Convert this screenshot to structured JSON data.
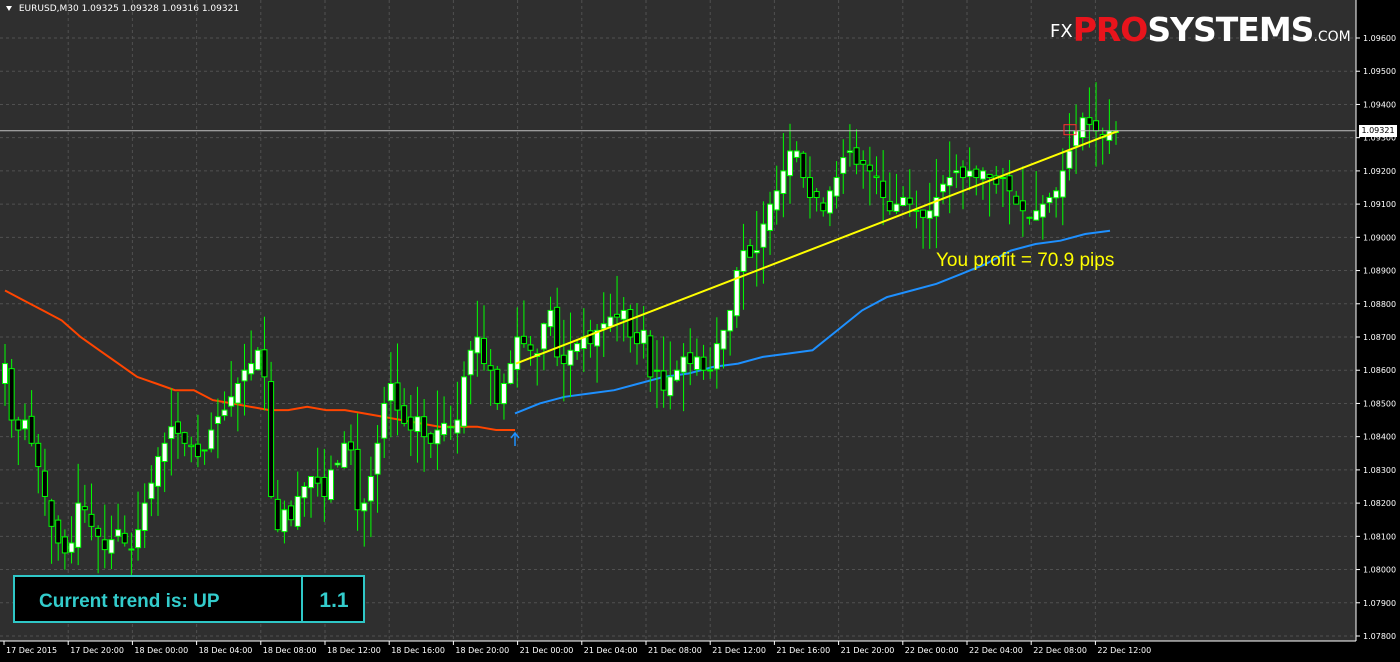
{
  "header": {
    "symbol": "EURUSD,M30",
    "ohlc": "1.09325 1.09328 1.09316 1.09321"
  },
  "logo": {
    "fx": "FX",
    "pro": "PRO",
    "systems": "SYSTEMS",
    "com": ".COM"
  },
  "current_price": "1.09321",
  "profit_text": "You profit = 70.9 pips",
  "trend": {
    "label": "Current trend is: UP",
    "value": "1.1"
  },
  "colors": {
    "background": "#000000",
    "chart_bg": "#2f2f2f",
    "grid": "#505050",
    "candle": "#00ff00",
    "candle_up_fill": "#ffffff",
    "ma_before": "#ff4500",
    "ma_after": "#1e90ff",
    "trend_line": "#ffff00",
    "trend_box": "#2fc7c7"
  },
  "chart_data": {
    "type": "candlestick",
    "symbol": "EURUSD",
    "timeframe": "M30",
    "y_ticks": [
      "1.09600",
      "1.09500",
      "1.09400",
      "1.09300",
      "1.09200",
      "1.09100",
      "1.09000",
      "1.08900",
      "1.08800",
      "1.08700",
      "1.08600",
      "1.08500",
      "1.08400",
      "1.08300",
      "1.08200",
      "1.08100",
      "1.08000",
      "1.07900",
      "1.07800"
    ],
    "ylim": [
      1.0777,
      1.0968
    ],
    "x_ticks": [
      "17 Dec 2015",
      "17 Dec 20:00",
      "18 Dec 00:00",
      "18 Dec 04:00",
      "18 Dec 08:00",
      "18 Dec 12:00",
      "18 Dec 16:00",
      "18 Dec 20:00",
      "21 Dec 00:00",
      "21 Dec 04:00",
      "21 Dec 08:00",
      "21 Dec 12:00",
      "21 Dec 16:00",
      "21 Dec 20:00",
      "22 Dec 00:00",
      "22 Dec 04:00",
      "22 Dec 08:00",
      "22 Dec 12:00"
    ],
    "close_series": [
      1.0862,
      1.0845,
      1.0842,
      1.0845,
      1.0838,
      1.0831,
      1.0822,
      1.0813,
      1.0808,
      1.0805,
      1.0808,
      1.082,
      1.0818,
      1.0813,
      1.081,
      1.0806,
      1.0809,
      1.0812,
      1.0808,
      1.0806,
      1.0812,
      1.082,
      1.0826,
      1.0834,
      1.0838,
      1.0843,
      1.0841,
      1.0838,
      1.0837,
      1.0834,
      1.0836,
      1.0842,
      1.0846,
      1.0848,
      1.0852,
      1.0856,
      1.086,
      1.0862,
      1.0866,
      1.0858,
      1.0822,
      1.0812,
      1.0818,
      1.0815,
      1.0822,
      1.0825,
      1.0828,
      1.0826,
      1.0822,
      1.083,
      1.0832,
      1.0838,
      1.0836,
      1.0818,
      1.082,
      1.0828,
      1.0838,
      1.085,
      1.0856,
      1.0848,
      1.0844,
      1.0842,
      1.0846,
      1.084,
      1.0838,
      1.0842,
      1.0844,
      1.0843,
      1.0845,
      1.0858,
      1.0866,
      1.087,
      1.0862,
      1.086,
      1.085,
      1.0856,
      1.0862,
      1.087,
      1.0868,
      1.0866,
      1.0865,
      1.0874,
      1.0878,
      1.0864,
      1.0862,
      1.0866,
      1.0868,
      1.087,
      1.0868,
      1.0872,
      1.0874,
      1.0876,
      1.0876,
      1.0878,
      1.087,
      1.0868,
      1.0872,
      1.0858,
      1.086,
      1.0854,
      1.0858,
      1.086,
      1.0864,
      1.0862,
      1.0864,
      1.086,
      1.086,
      1.0868,
      1.0872,
      1.0878,
      1.089,
      1.0896,
      1.0894,
      1.0896,
      1.0904,
      1.091,
      1.0914,
      1.092,
      1.0926,
      1.0926,
      1.0918,
      1.0912,
      1.0912,
      1.0908,
      1.0914,
      1.0918,
      1.0924,
      1.0926,
      1.0922,
      1.0922,
      1.092,
      1.0918,
      1.0912,
      1.0908,
      1.091,
      1.0912,
      1.091,
      1.0908,
      1.0906,
      1.0908,
      1.0912,
      1.0916,
      1.0918,
      1.092,
      1.0918,
      1.092,
      1.0918,
      1.092,
      1.0918,
      1.0916,
      1.0918,
      1.0914,
      1.091,
      1.0908,
      1.0906,
      1.0908,
      1.091,
      1.0912,
      1.0914,
      1.092,
      1.0926,
      1.0932,
      1.0936,
      1.0934,
      1.0932,
      1.093,
      1.0932,
      1.0932
    ],
    "moving_average": {
      "before_signal": [
        1.0884,
        1.0881,
        1.0878,
        1.0875,
        1.087,
        1.0866,
        1.0862,
        1.0858,
        1.0856,
        1.0854,
        1.0854,
        1.0851,
        1.085,
        1.0849,
        1.0848,
        1.0848,
        1.0849,
        1.0848,
        1.0848,
        1.0847,
        1.0846,
        1.0845,
        1.0844,
        1.0843,
        1.0843,
        1.0843,
        1.0842,
        1.0842
      ],
      "after_signal": [
        1.0847,
        1.085,
        1.0852,
        1.0853,
        1.0854,
        1.0856,
        1.0858,
        1.0859,
        1.0861,
        1.0862,
        1.0864,
        1.0865,
        1.0866,
        1.0872,
        1.0878,
        1.0882,
        1.0884,
        1.0886,
        1.0889,
        1.0892,
        1.0896,
        1.0898,
        1.0899,
        1.0901,
        1.0902
      ]
    },
    "trend_line": {
      "from": 1.0862,
      "to": 1.0932
    },
    "current_price": 1.09321,
    "signal": "up-arrow"
  }
}
